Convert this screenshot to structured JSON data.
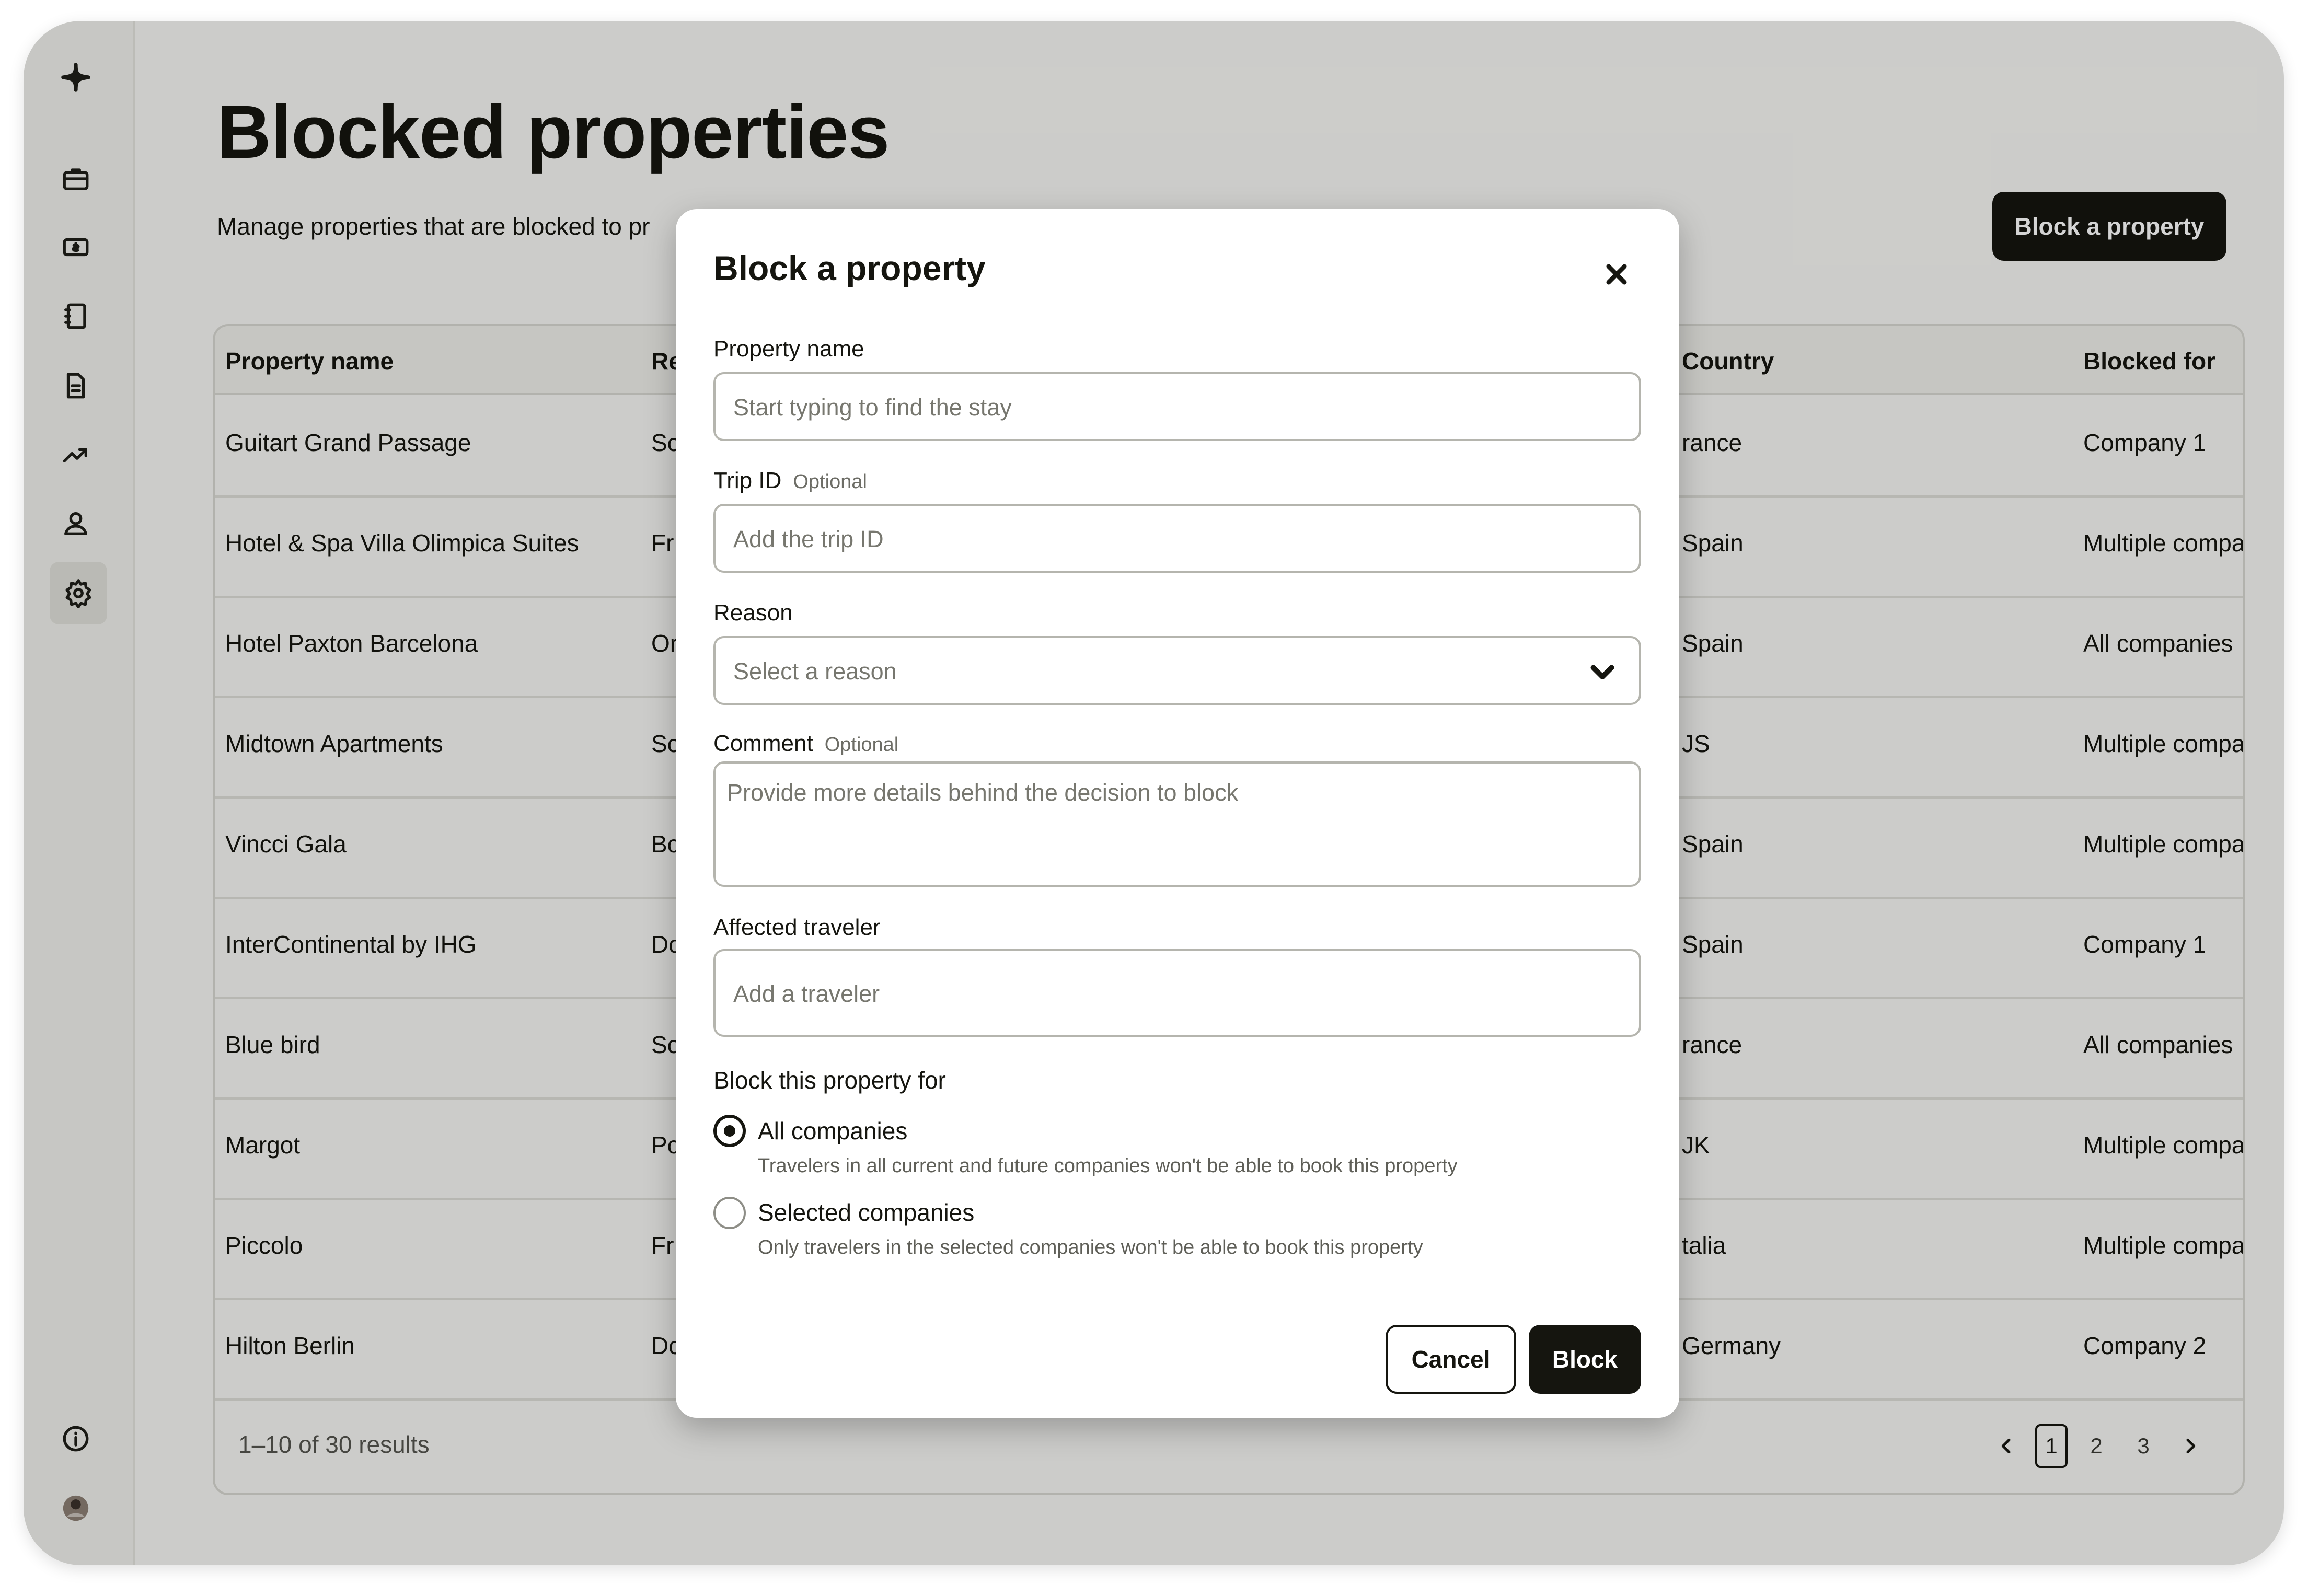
{
  "page": {
    "title": "Blocked properties",
    "subtitle": "Manage properties that are blocked to pr",
    "block_button_label": "Block a property"
  },
  "sidebar": {
    "items": [
      {
        "icon": "logo-sparkle-icon"
      },
      {
        "icon": "briefcase-icon"
      },
      {
        "icon": "money-icon"
      },
      {
        "icon": "notebook-icon"
      },
      {
        "icon": "document-icon"
      },
      {
        "icon": "trend-chart-icon"
      },
      {
        "icon": "user-icon"
      },
      {
        "icon": "gear-icon",
        "active": true
      }
    ],
    "bottom": [
      {
        "icon": "info-icon"
      },
      {
        "icon": "avatar"
      }
    ]
  },
  "table": {
    "headers": [
      "Property name",
      "Re",
      "Country",
      "Blocked for"
    ],
    "rows": [
      [
        "Guitart Grand Passage",
        "Sc",
        "rance",
        "Company 1"
      ],
      [
        "Hotel & Spa Villa Olimpica Suites",
        "Fr",
        "Spain",
        "Multiple companies"
      ],
      [
        "Hotel Paxton Barcelona",
        "Or",
        "Spain",
        "All companies"
      ],
      [
        "Midtown Apartments",
        "Sc",
        "JS",
        "Multiple companies"
      ],
      [
        "Vincci Gala",
        "Bc",
        "Spain",
        "Multiple companies"
      ],
      [
        "InterContinental by IHG",
        "Dc",
        "Spain",
        "Company 1"
      ],
      [
        "Blue bird",
        "Sc",
        "rance",
        "All companies"
      ],
      [
        "Margot",
        "Pc",
        "JK",
        "Multiple companies"
      ],
      [
        "Piccolo",
        "Fr",
        "talia",
        "Multiple companies"
      ],
      [
        "Hilton Berlin",
        "Dc",
        "Germany",
        "Company 2"
      ]
    ],
    "results_text": "1–10 of 30 results",
    "pages": [
      "1",
      "2",
      "3"
    ],
    "current_page": "1"
  },
  "modal": {
    "title": "Block a property",
    "property_name": {
      "label": "Property name",
      "placeholder": "Start typing to find the stay"
    },
    "trip_id": {
      "label": "Trip ID",
      "optional": "Optional",
      "placeholder": "Add the trip ID"
    },
    "reason": {
      "label": "Reason",
      "placeholder": "Select a reason"
    },
    "comment": {
      "label": "Comment",
      "optional": "Optional",
      "placeholder": "Provide more details behind the decision to block"
    },
    "traveler": {
      "label": "Affected traveler",
      "placeholder": "Add a traveler"
    },
    "block_for": {
      "label": "Block this property for",
      "options": [
        {
          "label": "All companies",
          "help": "Travelers in all current and future companies won't be able to book this property",
          "selected": true
        },
        {
          "label": "Selected companies",
          "help": "Only travelers in the selected companies won't be able to book this property",
          "selected": false
        }
      ]
    },
    "cancel_label": "Cancel",
    "block_label": "Block"
  }
}
